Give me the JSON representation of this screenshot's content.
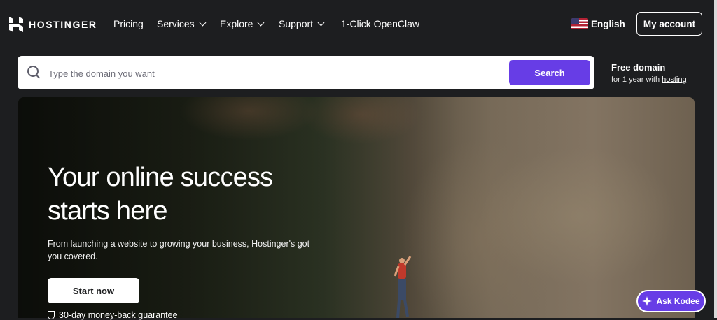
{
  "nav": {
    "logo": "HOSTINGER",
    "items": [
      {
        "label": "Pricing",
        "dropdown": false
      },
      {
        "label": "Services",
        "dropdown": true
      },
      {
        "label": "Explore",
        "dropdown": true
      },
      {
        "label": "Support",
        "dropdown": true
      },
      {
        "label": "1-Click OpenClaw",
        "dropdown": false
      }
    ],
    "language": "English",
    "account": "My account"
  },
  "search": {
    "placeholder": "Type the domain you want",
    "button": "Search",
    "promo_title": "Free domain",
    "promo_prefix": "for 1 year with ",
    "promo_link": "hosting"
  },
  "hero": {
    "title": "Your online success starts here",
    "subtitle": "From launching a website to growing your business, Hostinger's got you covered.",
    "cta": "Start now",
    "guarantee": "30-day money-back guarantee"
  },
  "chat": {
    "label": "Ask Kodee"
  },
  "colors": {
    "brand": "#673de6",
    "background": "#1d1e20"
  }
}
